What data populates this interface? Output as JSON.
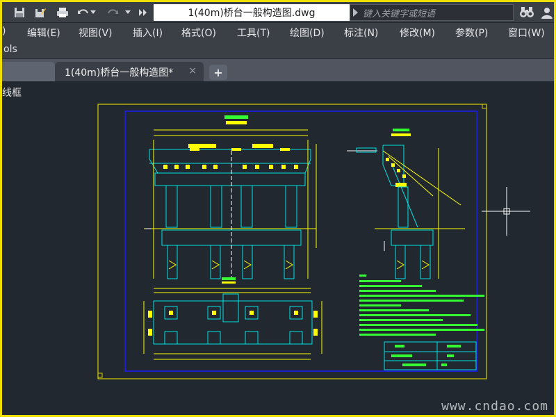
{
  "quick_access": {
    "icons": [
      "save-icon",
      "save-as-icon",
      "print-icon",
      "undo-icon",
      "redo-icon",
      "more-icon"
    ],
    "document_title": "1(40m)桥台一般构造图.dwg",
    "search_placeholder": "键入关键字或短语"
  },
  "menu": {
    "items": [
      {
        "label": ")"
      },
      {
        "label": "编辑(E)"
      },
      {
        "label": "视图(V)"
      },
      {
        "label": "插入(I)"
      },
      {
        "label": "格式(O)"
      },
      {
        "label": "工具(T)"
      },
      {
        "label": "绘图(D)"
      },
      {
        "label": "标注(N)"
      },
      {
        "label": "修改(M)"
      },
      {
        "label": "参数(P)"
      },
      {
        "label": "窗口(W)"
      }
    ],
    "second_row": "ols"
  },
  "tabs": {
    "items": [
      {
        "label": ""
      },
      {
        "label": "1(40m)桥台一般构造图*"
      }
    ],
    "close_glyph": "×",
    "add_glyph": "+"
  },
  "viewport": {
    "label": "线框",
    "watermark": "www.cndao.com"
  },
  "colors": {
    "border": "#f0e000",
    "cyan": "#00e5e5",
    "yellow": "#ffff00",
    "green": "#33ff33",
    "blue": "#1a1aff",
    "canvas": "#212830"
  }
}
